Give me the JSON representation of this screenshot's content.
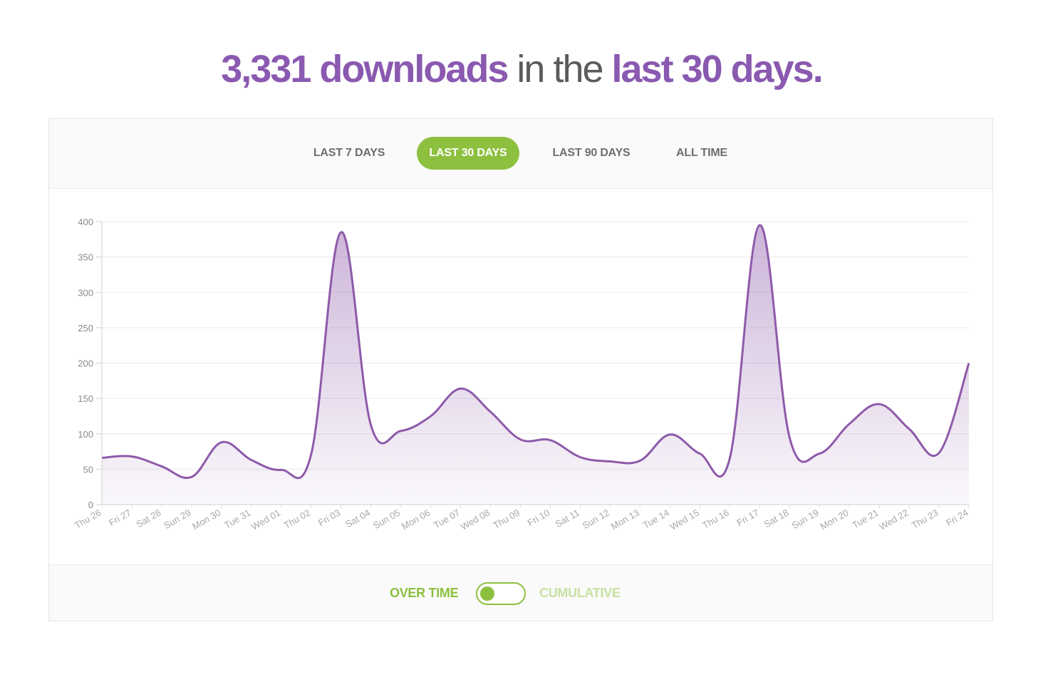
{
  "headline": {
    "count": "3,331 downloads",
    "middle": " in the ",
    "period": "last 30 days."
  },
  "tabs": [
    {
      "label": "LAST 7 DAYS",
      "active": false
    },
    {
      "label": "LAST 30 DAYS",
      "active": true
    },
    {
      "label": "LAST 90 DAYS",
      "active": false
    },
    {
      "label": "ALL TIME",
      "active": false
    }
  ],
  "toggle": {
    "left_label": "OVER TIME",
    "right_label": "CUMULATIVE",
    "state": "over-time"
  },
  "colors": {
    "accent_purple": "#8a59b0",
    "accent_green": "#8dc03f",
    "line": "#8e5aaa"
  },
  "chart_data": {
    "type": "area",
    "categories": [
      "Thu 26",
      "Fri 27",
      "Sat 28",
      "Sun 29",
      "Mon 30",
      "Tue 31",
      "Wed 01",
      "Thu 02",
      "Fri 03",
      "Sat 04",
      "Sun 05",
      "Mon 06",
      "Tue 07",
      "Wed 08",
      "Thu 09",
      "Fri 10",
      "Sat 11",
      "Sun 12",
      "Mon 13",
      "Tue 14",
      "Wed 15",
      "Thu 16",
      "Fri 17",
      "Sat 18",
      "Sun 19",
      "Mon 20",
      "Tue 21",
      "Wed 22",
      "Thu 23",
      "Fri 24"
    ],
    "values": [
      66,
      68,
      54,
      39,
      88,
      63,
      49,
      71,
      385,
      112,
      104,
      125,
      164,
      131,
      92,
      91,
      67,
      61,
      62,
      99,
      72,
      65,
      395,
      95,
      72,
      114,
      142,
      107,
      73,
      200
    ],
    "ylim": [
      0,
      400
    ],
    "yticks": [
      0,
      50,
      100,
      150,
      200,
      250,
      300,
      350,
      400
    ],
    "grid": true,
    "title": "",
    "xlabel": "",
    "ylabel": ""
  }
}
